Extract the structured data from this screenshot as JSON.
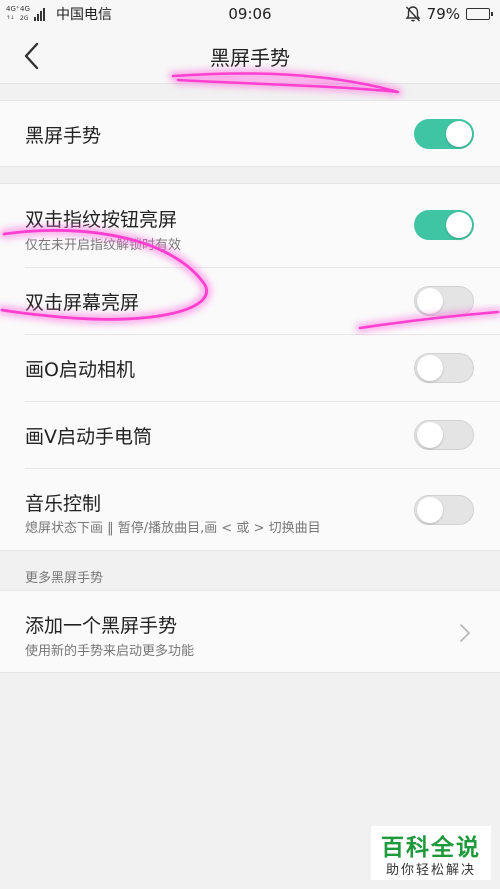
{
  "status_bar": {
    "network_1": "4G⁺",
    "network_1_sub": "↑↓",
    "network_2": "4G",
    "network_2_sub": "2G",
    "carrier": "中国电信",
    "time": "09:06",
    "battery": "79%",
    "battery_level": 0.79
  },
  "header": {
    "title": "黑屏手势",
    "back_icon": "chevron-left-icon"
  },
  "main_toggle": {
    "label": "黑屏手势",
    "on": true
  },
  "gesture_items": [
    {
      "label": "双击指纹按钮亮屏",
      "sub": "仅在未开启指纹解锁时有效",
      "on": true
    },
    {
      "label": "双击屏幕亮屏",
      "sub": "",
      "on": false
    },
    {
      "label": "画O启动相机",
      "sub": "",
      "on": false
    },
    {
      "label": "画V启动手电筒",
      "sub": "",
      "on": false
    },
    {
      "label": "音乐控制",
      "sub": "熄屏状态下画 ‖ 暂停/播放曲目,画 < 或 > 切换曲目",
      "on": false
    }
  ],
  "more_section": {
    "header": "更多黑屏手势",
    "add_label": "添加一个黑屏手势",
    "add_sub": "使用新的手势来启动更多功能",
    "chevron_icon": "chevron-right-icon"
  },
  "watermark": {
    "main": "百科全说",
    "sub": "助你轻松解决"
  },
  "colors": {
    "toggle_on": "#3fc5a3",
    "toggle_off": "#e4e4e4",
    "scribble": "#ff3fd0",
    "watermark_green": "#1e9a3c"
  }
}
